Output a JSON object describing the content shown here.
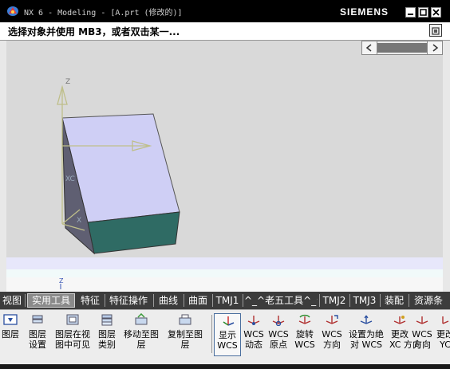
{
  "window": {
    "title": "NX 6 - Modeling - [A.prt (修改的)]",
    "brand": "SIEMENS"
  },
  "prompt": {
    "text": "选择对象并使用 MB3，或者双击某一..."
  },
  "viewport": {
    "axis_y_top": "Z",
    "axis_zc_label": "XC",
    "axis_x_label": "X",
    "wcs_label": "Z",
    "colors": {
      "background": "#d9d9d9",
      "block_top": "#cfcff5",
      "block_front": "#2f6b64",
      "block_side": "#646478",
      "floor": "#e8e8ff"
    }
  },
  "tabs": [
    "视图",
    "实用工具",
    "特征",
    "特征操作",
    "曲线",
    "曲面",
    "TMJ1",
    "^_^老五工具^_^",
    "TMJ2",
    "TMJ3",
    "装配",
    "资源条"
  ],
  "active_tab": "实用工具",
  "tools": [
    {
      "label": "图层",
      "icon": "layer-icon"
    },
    {
      "label": "图层\n设置",
      "icon": "layer-settings-icon"
    },
    {
      "label": "图层在视\n图中可见",
      "icon": "layer-visible-icon"
    },
    {
      "label": "图层\n类别",
      "icon": "layer-category-icon"
    },
    {
      "label": "移动至图\n层",
      "icon": "move-to-layer-icon"
    },
    {
      "label": "复制至图\n层",
      "icon": "copy-to-layer-icon"
    },
    {
      "label": "显示\nWCS",
      "icon": "display-wcs-icon"
    },
    {
      "label": "WCS\n动态",
      "icon": "wcs-dynamic-icon"
    },
    {
      "label": "WCS\n原点",
      "icon": "wcs-origin-icon"
    },
    {
      "label": "旋转\nWCS",
      "icon": "rotate-wcs-icon"
    },
    {
      "label": "WCS\n方向",
      "icon": "wcs-orient-icon"
    },
    {
      "label": "设置为绝\n对 WCS",
      "icon": "set-absolute-wcs-icon"
    },
    {
      "label": "更改\nXC 方向",
      "icon": "change-xc-icon"
    },
    {
      "label": "WCS\n方向",
      "icon": "wcs-direction-icon"
    },
    {
      "label": "更改\nYC",
      "icon": "change-yc-icon"
    }
  ]
}
